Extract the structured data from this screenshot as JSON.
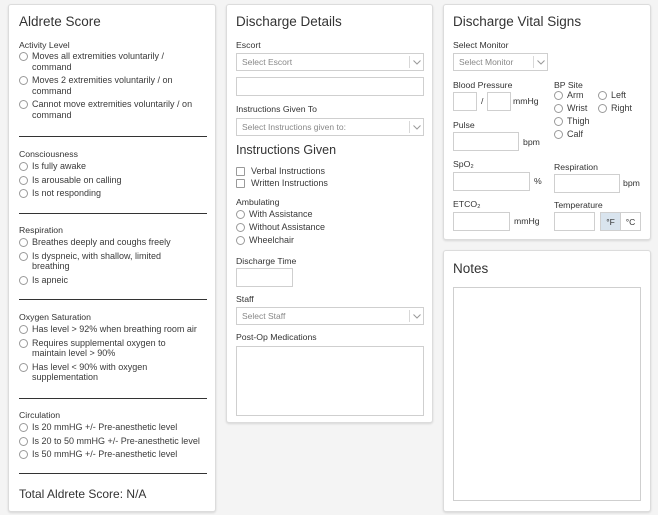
{
  "aldrete": {
    "title": "Aldrete Score",
    "activity": {
      "label": "Activity Level",
      "options": [
        [
          "Moves all extremities voluntarily /",
          "command"
        ],
        [
          "Moves 2 extremities voluntarily / on",
          "command"
        ],
        [
          "Cannot move extremities voluntarily / on",
          "command"
        ]
      ]
    },
    "consciousness": {
      "label": "Consciousness",
      "options": [
        "Is fully awake",
        "Is arousable on calling",
        "Is not responding"
      ]
    },
    "respiration": {
      "label": "Respiration",
      "options": [
        [
          "Breathes deeply and coughs freely"
        ],
        [
          "Is dyspneic, with shallow, limited",
          "breathing"
        ],
        [
          "Is apneic"
        ]
      ]
    },
    "oxygen": {
      "label": "Oxygen Saturation",
      "options": [
        [
          "Has level > 92% when breathing room air"
        ],
        [
          "Requires supplemental oxygen to",
          "maintain level > 90%"
        ],
        [
          "Has level < 90% with oxygen",
          "supplementation"
        ]
      ]
    },
    "circulation": {
      "label": "Circulation",
      "options": [
        "Is 20 mmHG +/- Pre-anesthetic level",
        "Is 20 to 50 mmHG +/- Pre-anesthetic level",
        "Is 50 mmHG +/- Pre-anesthetic level"
      ]
    },
    "total_label": "Total Aldrete Score:",
    "total_value": "N/A"
  },
  "discharge": {
    "title": "Discharge Details",
    "escort_label": "Escort",
    "escort_placeholder": "Select Escort",
    "instructions_to_label": "Instructions Given To",
    "instructions_to_placeholder": "Select Instructions given to:",
    "instructions_given_title": "Instructions Given",
    "verbal": "Verbal Instructions",
    "written": "Written Instructions",
    "ambulating_label": "Ambulating",
    "ambulating_options": [
      "With Assistance",
      "Without Assistance",
      "Wheelchair"
    ],
    "time_label": "Discharge Time",
    "staff_label": "Staff",
    "staff_placeholder": "Select Staff",
    "meds_label": "Post-Op Medications"
  },
  "vitals": {
    "title": "Discharge Vital Signs",
    "monitor_label": "Select Monitor",
    "monitor_placeholder": "Select Monitor",
    "bp_label": "Blood Pressure",
    "bp_sep": "/",
    "bp_unit": "mmHg",
    "bp_site_label": "BP Site",
    "bp_sites_left": [
      "Arm",
      "Wrist",
      "Thigh",
      "Calf"
    ],
    "bp_sites_right": [
      "Left",
      "Right"
    ],
    "pulse_label": "Pulse",
    "pulse_unit": "bpm",
    "spo2_label": "SpO₂",
    "spo2_unit": "%",
    "resp_label": "Respiration",
    "resp_unit": "bpm",
    "etco2_label": "ETCO₂",
    "etco2_unit": "mmHg",
    "temp_label": "Temperature",
    "temp_f": "°F",
    "temp_c": "°C"
  },
  "notes": {
    "title": "Notes"
  }
}
